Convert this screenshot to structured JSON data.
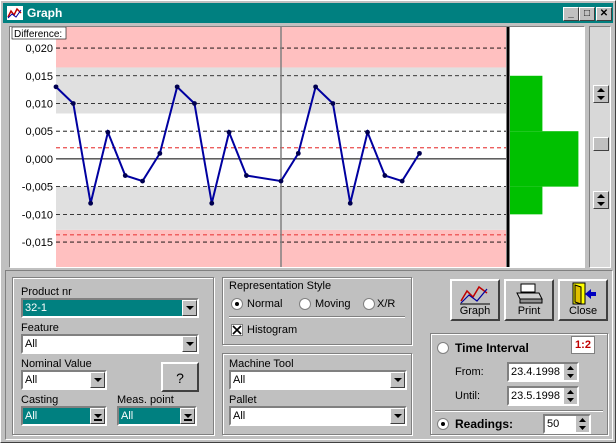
{
  "window": {
    "title": "Graph",
    "minimize": "_",
    "maximize": "□",
    "close": "✕"
  },
  "chart_data": {
    "type": "line",
    "y_axis_label": "Difference:",
    "y_ticks": [
      "0,020",
      "0,015",
      "0,010",
      "0,005",
      "0,000",
      "-0,005",
      "-0,010",
      "-0,015"
    ],
    "y_tick_values": [
      0.02,
      0.015,
      0.01,
      0.005,
      0.0,
      -0.005,
      -0.01,
      -0.015
    ],
    "ylim": [
      -0.0195,
      0.0238
    ],
    "bands": [
      {
        "from": 0.0165,
        "to": 0.0238,
        "color": "#ffc0c0"
      },
      {
        "from": -0.0195,
        "to": -0.0128,
        "color": "#ffc0c0"
      },
      {
        "from": 0.0082,
        "to": 0.0165,
        "color": "#e0e0e0"
      },
      {
        "from": -0.0128,
        "to": -0.005,
        "color": "#e0e0e0"
      }
    ],
    "dashed_lines": [
      0.02,
      0.015,
      0.01,
      0.005,
      -0.005,
      -0.01,
      -0.015
    ],
    "red_dashed_lines": [
      0.002,
      -0.0137
    ],
    "x_count": 27,
    "divider_index": 13,
    "series": [
      {
        "color": "#0000a0",
        "values": [
          0.013,
          0.01,
          -0.008,
          0.0048,
          -0.003,
          -0.004,
          0.001,
          0.013,
          0.01,
          -0.008,
          0.0048,
          -0.003,
          -0.004,
          0.001,
          0.013,
          0.01,
          -0.008,
          0.0048,
          -0.003,
          -0.004,
          0.001
        ]
      }
    ],
    "x_indices": [
      0,
      1,
      2,
      3,
      4,
      5,
      6,
      7,
      8,
      9,
      10,
      11,
      13,
      14,
      15,
      16,
      17,
      18,
      19,
      20,
      21
    ],
    "histogram": {
      "color": "#00c000",
      "bins": [
        {
          "from": 0.015,
          "to": 0.005,
          "value": 0.45
        },
        {
          "from": 0.005,
          "to": -0.005,
          "value": 0.95
        },
        {
          "from": -0.005,
          "to": -0.01,
          "value": 0.45
        }
      ]
    }
  },
  "form": {
    "product_nr": {
      "label": "Product nr",
      "value": "32-1"
    },
    "feature": {
      "label": "Feature",
      "value": "All"
    },
    "nominal_value": {
      "label": "Nominal Value",
      "value": "All"
    },
    "help_button": "?",
    "casting": {
      "label": "Casting",
      "value": "All"
    },
    "meas_point": {
      "label": "Meas. point",
      "value": "All"
    },
    "representation": {
      "title": "Representation Style",
      "options": [
        "Normal",
        "Moving",
        "X/R"
      ],
      "selected": "Normal",
      "histogram_label": "Histogram",
      "histogram_checked": true
    },
    "machine_tool": {
      "label": "Machine Tool",
      "value": "All"
    },
    "pallet": {
      "label": "Pallet",
      "value": "All"
    },
    "buttons": {
      "graph": "Graph",
      "print": "Print",
      "close": "Close"
    },
    "time_interval": {
      "label": "Time Interval",
      "from_label": "From:",
      "from": "23.4.1998",
      "until_label": "Until:",
      "until": "23.5.1998",
      "icon_text": "1:2"
    },
    "readings": {
      "label": "Readings:",
      "value": "50"
    }
  }
}
